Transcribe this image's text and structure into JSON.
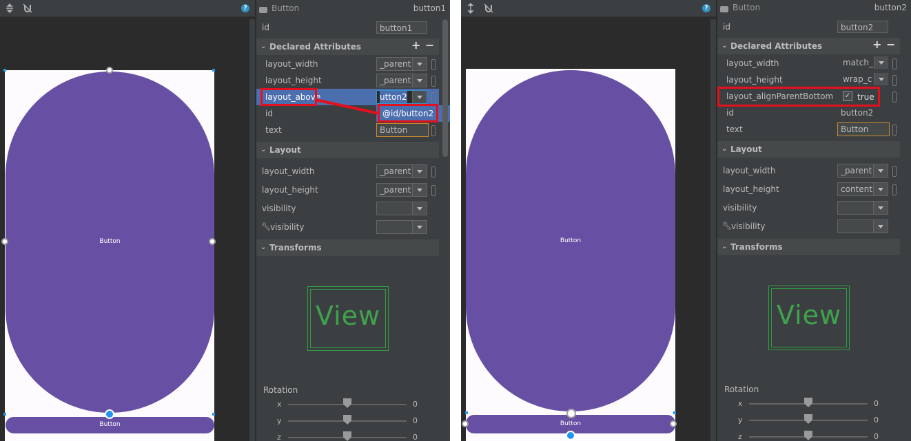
{
  "left": {
    "panel": {
      "title": "Button",
      "id_value": "button1",
      "id_label": "id",
      "declared_section": "Declared Attributes",
      "declared": [
        {
          "label": "layout_width",
          "value": "_parent"
        },
        {
          "label": "layout_height",
          "value": "_parent"
        },
        {
          "label": "layout_above",
          "value": "utton2"
        },
        {
          "label": "id",
          "value": ""
        },
        {
          "label": "text",
          "value": "Button"
        }
      ],
      "dropdown_suggestion": "@id/button2",
      "layout_section": "Layout",
      "layout": [
        {
          "label": "layout_width",
          "value": "_parent"
        },
        {
          "label": "layout_height",
          "value": "_parent"
        },
        {
          "label": "visibility",
          "value": ""
        },
        {
          "label": "visibility",
          "value": ""
        }
      ],
      "transforms_section": "Transforms",
      "view_text": "View",
      "rotation_label": "Rotation",
      "rotation": [
        {
          "axis": "x",
          "value": "0"
        },
        {
          "axis": "y",
          "value": "0"
        },
        {
          "axis": "z",
          "value": "0"
        }
      ]
    },
    "canvas": {
      "big_button": "Button",
      "small_button": "Button"
    }
  },
  "right": {
    "panel": {
      "title": "Button",
      "id_value": "button2",
      "id_label": "id",
      "declared_section": "Declared Attributes",
      "declared": [
        {
          "label": "layout_width",
          "value": "match_"
        },
        {
          "label": "layout_height",
          "value": "wrap_c"
        },
        {
          "label": "layout_alignParentBottom",
          "value": "true"
        },
        {
          "label": "id",
          "value": "button2"
        },
        {
          "label": "text",
          "value": "Button"
        }
      ],
      "layout_section": "Layout",
      "layout": [
        {
          "label": "layout_width",
          "value": "_parent"
        },
        {
          "label": "layout_height",
          "value": "content"
        },
        {
          "label": "visibility",
          "value": ""
        },
        {
          "label": "visibility",
          "value": ""
        }
      ],
      "transforms_section": "Transforms",
      "view_text": "View",
      "rotation_label": "Rotation",
      "rotation": [
        {
          "axis": "x",
          "value": "0"
        },
        {
          "axis": "y",
          "value": "0"
        },
        {
          "axis": "z",
          "value": "0"
        }
      ]
    },
    "canvas": {
      "big_button": "Button",
      "small_button": "Button"
    }
  },
  "help_glyph": "?",
  "checkbox_glyph": "✓",
  "colors": {
    "accent": "#6750a4",
    "highlight": "#e5101d",
    "selection": "#4b6eaf",
    "view_green": "#2f9e44"
  }
}
